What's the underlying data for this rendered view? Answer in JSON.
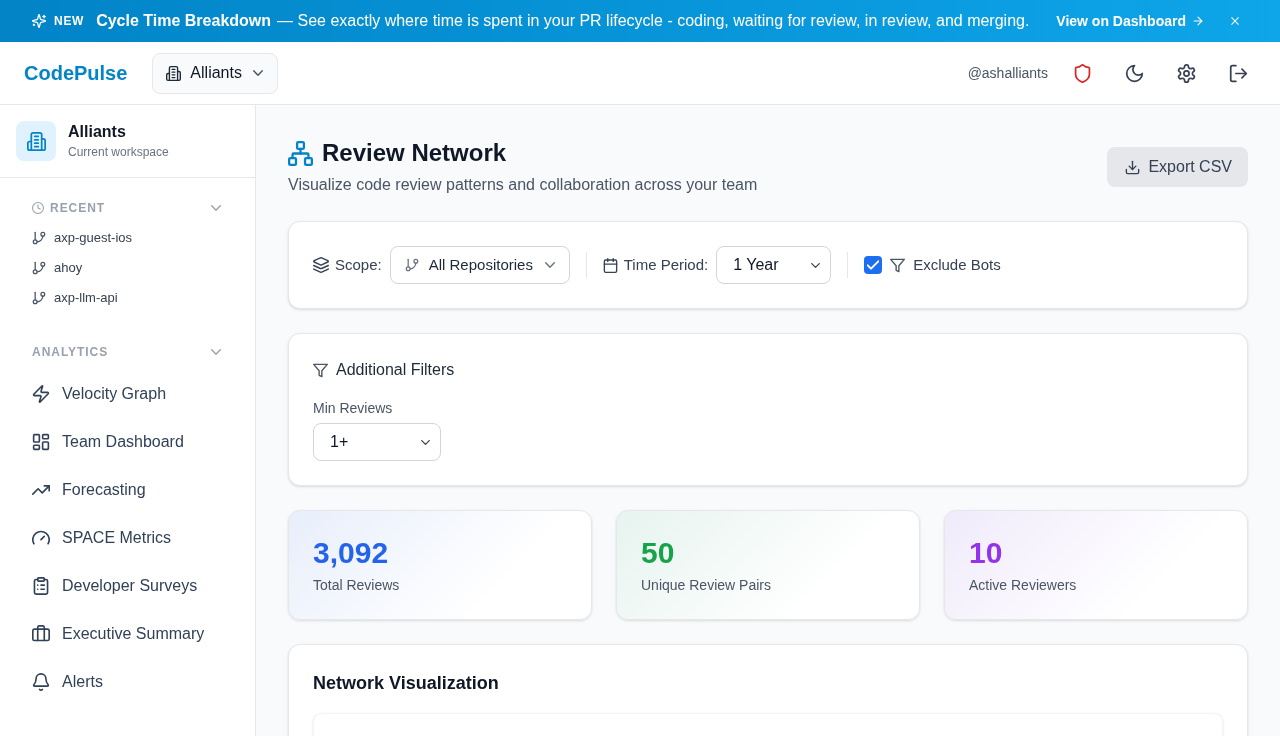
{
  "banner": {
    "badge": "NEW",
    "title": "Cycle Time Breakdown",
    "text": "— See exactly where time is spent in your PR lifecycle - coding, waiting for review, in review, and merging.",
    "link": "View on Dashboard"
  },
  "header": {
    "logo": "CodePulse",
    "workspace": "Alliants",
    "username": "@ashalliants"
  },
  "sidebar": {
    "workspace": {
      "name": "Alliants",
      "subtitle": "Current workspace"
    },
    "recent": {
      "title": "RECENT",
      "items": [
        {
          "label": "axp-guest-ios"
        },
        {
          "label": "ahoy"
        },
        {
          "label": "axp-llm-api"
        }
      ]
    },
    "analytics": {
      "title": "ANALYTICS",
      "items": [
        {
          "label": "Velocity Graph"
        },
        {
          "label": "Team Dashboard"
        },
        {
          "label": "Forecasting"
        },
        {
          "label": "SPACE Metrics"
        },
        {
          "label": "Developer Surveys"
        },
        {
          "label": "Executive Summary"
        },
        {
          "label": "Alerts"
        }
      ]
    }
  },
  "page": {
    "title": "Review Network",
    "subtitle": "Visualize code review patterns and collaboration across your team",
    "export_button": "Export CSV"
  },
  "filters": {
    "scope": {
      "label": "Scope:",
      "value": "All Repositories"
    },
    "time_period": {
      "label": "Time Period:",
      "value": "1 Year"
    },
    "exclude_bots": {
      "label": "Exclude Bots",
      "checked": true
    }
  },
  "additional_filters": {
    "title": "Additional Filters",
    "min_reviews": {
      "label": "Min Reviews",
      "value": "1+"
    }
  },
  "stats": [
    {
      "value": "3,092",
      "label": "Total Reviews",
      "color": "#2563eb"
    },
    {
      "value": "50",
      "label": "Unique Review Pairs",
      "color": "#16a34a"
    },
    {
      "value": "10",
      "label": "Active Reviewers",
      "color": "#9333ea"
    }
  ],
  "network": {
    "title": "Network Visualization"
  }
}
